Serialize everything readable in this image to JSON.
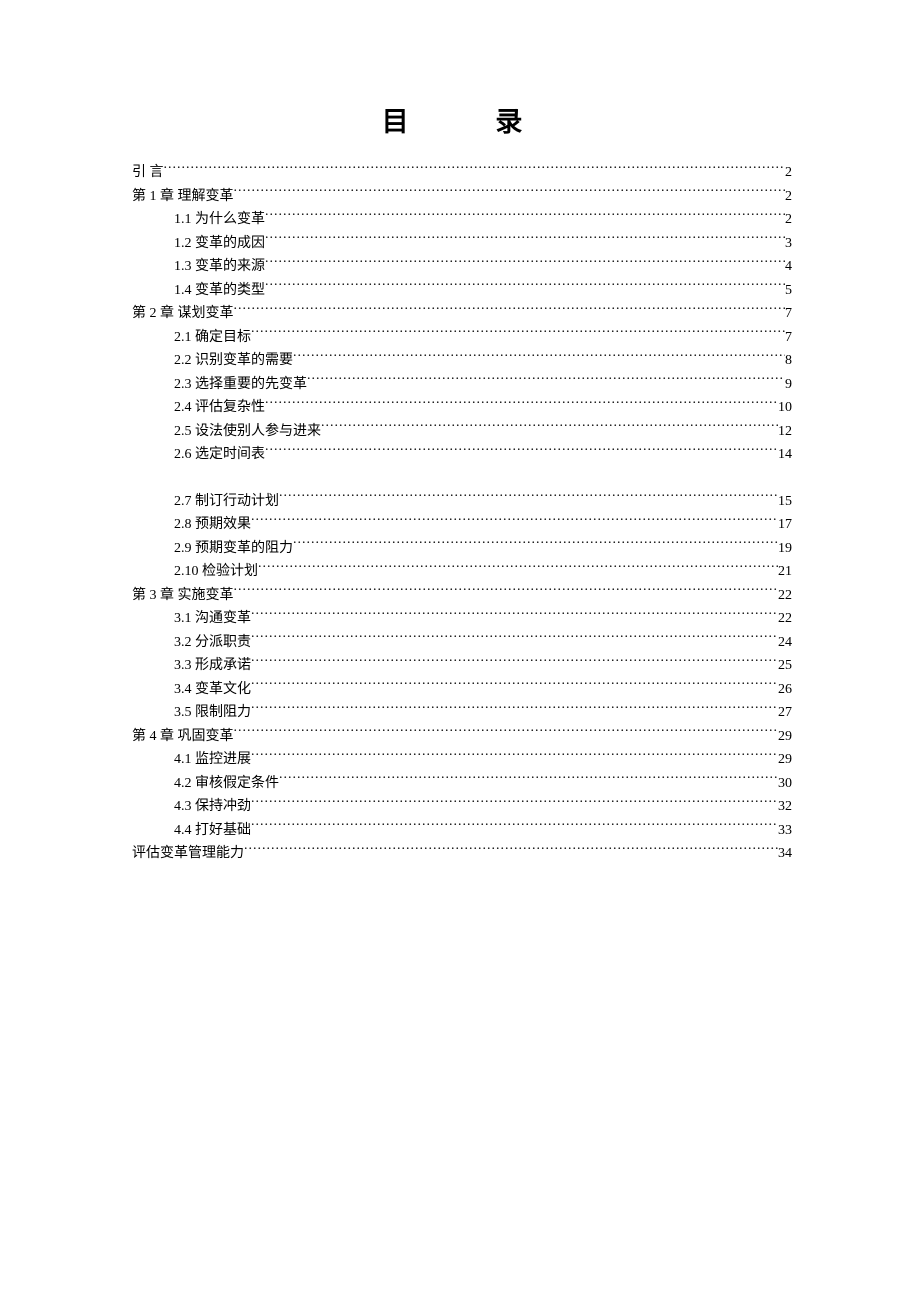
{
  "title": "目  录",
  "entries": [
    {
      "label": "引  言",
      "page": "2",
      "indent": false
    },
    {
      "label": "第 1 章   理解变革",
      "page": "2",
      "indent": false
    },
    {
      "label": "1.1 为什么变革",
      "page": "2",
      "indent": true
    },
    {
      "label": "1.2 变革的成因",
      "page": "3",
      "indent": true
    },
    {
      "label": "1.3 变革的来源",
      "page": "4",
      "indent": true
    },
    {
      "label": "1.4 变革的类型",
      "page": "5",
      "indent": true
    },
    {
      "label": "第 2 章   谋划变革",
      "page": "7",
      "indent": false
    },
    {
      "label": "2.1 确定目标",
      "page": "7",
      "indent": true
    },
    {
      "label": "2.2 识别变革的需要",
      "page": "8",
      "indent": true
    },
    {
      "label": "2.3 选择重要的先变革",
      "page": "9",
      "indent": true
    },
    {
      "label": "2.4 评估复杂性",
      "page": "10",
      "indent": true
    },
    {
      "label": "2.5 设法使别人参与进来",
      "page": "12",
      "indent": true
    },
    {
      "label": "2.6 选定时间表",
      "page": "14",
      "indent": true
    },
    {
      "gap": true
    },
    {
      "label": "2.7 制订行动计划",
      "page": "15",
      "indent": true
    },
    {
      "label": "2.8 预期效果",
      "page": "17",
      "indent": true
    },
    {
      "label": "2.9 预期变革的阻力",
      "page": "19",
      "indent": true
    },
    {
      "label": "2.10 检验计划",
      "page": "21",
      "indent": true
    },
    {
      "label": "第 3 章   实施变革",
      "page": "22",
      "indent": false
    },
    {
      "label": "3.1 沟通变革",
      "page": "22",
      "indent": true
    },
    {
      "label": "3.2 分派职责",
      "page": "24",
      "indent": true
    },
    {
      "label": "3.3 形成承诺",
      "page": "25",
      "indent": true
    },
    {
      "label": "3.4 变革文化",
      "page": "26",
      "indent": true
    },
    {
      "label": "3.5 限制阻力",
      "page": "27",
      "indent": true
    },
    {
      "label": "第 4 章   巩固变革",
      "page": "29",
      "indent": false
    },
    {
      "label": "4.1 监控进展",
      "page": "29",
      "indent": true
    },
    {
      "label": "4.2 审核假定条件",
      "page": "30",
      "indent": true
    },
    {
      "label": "4.3 保持冲劲",
      "page": "32",
      "indent": true
    },
    {
      "label": "4.4 打好基础",
      "page": "33",
      "indent": true
    },
    {
      "label": "评估变革管理能力",
      "page": "34",
      "indent": false
    }
  ]
}
